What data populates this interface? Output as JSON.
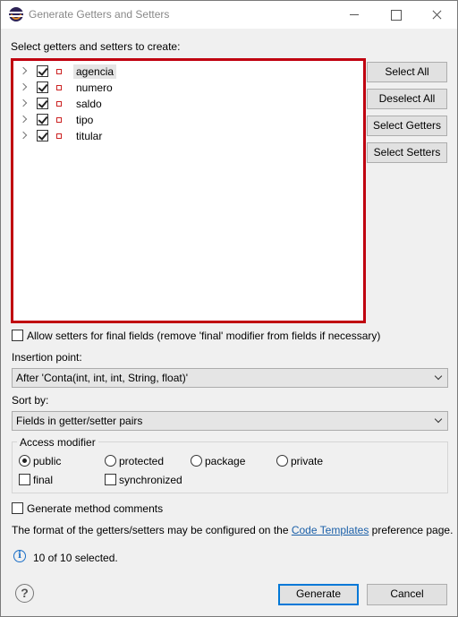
{
  "window": {
    "title": "Generate Getters and Setters"
  },
  "tree": {
    "label": "Select getters and setters to create:",
    "items": [
      {
        "name": "agencia",
        "checked": true,
        "selected": true
      },
      {
        "name": "numero",
        "checked": true,
        "selected": false
      },
      {
        "name": "saldo",
        "checked": true,
        "selected": false
      },
      {
        "name": "tipo",
        "checked": true,
        "selected": false
      },
      {
        "name": "titular",
        "checked": true,
        "selected": false
      }
    ]
  },
  "side_buttons": {
    "select_all": "Select All",
    "deselect_all": "Deselect All",
    "select_getters": "Select Getters",
    "select_setters": "Select Setters"
  },
  "allow_final": {
    "label": "Allow setters for final fields (remove 'final' modifier from fields if necessary)",
    "checked": false
  },
  "insertion_point": {
    "label": "Insertion point:",
    "value": "After 'Conta(int, int, int, String, float)'"
  },
  "sort_by": {
    "label": "Sort by:",
    "value": "Fields in getter/setter pairs"
  },
  "access_modifier": {
    "title": "Access modifier",
    "options": [
      "public",
      "protected",
      "package",
      "private"
    ],
    "selected": "public",
    "final_label": "final",
    "synchronized_label": "synchronized"
  },
  "generate_comments": {
    "label": "Generate method comments",
    "checked": false
  },
  "format_note": {
    "prefix": "The format of the getters/setters may be configured on the ",
    "link": "Code Templates",
    "suffix": " preference page."
  },
  "status": {
    "text": "10 of 10 selected."
  },
  "footer": {
    "generate": "Generate",
    "cancel": "Cancel"
  },
  "colors": {
    "highlight_border": "#c0000f",
    "link": "#1a5fa8",
    "default_button_border": "#0078d7"
  }
}
